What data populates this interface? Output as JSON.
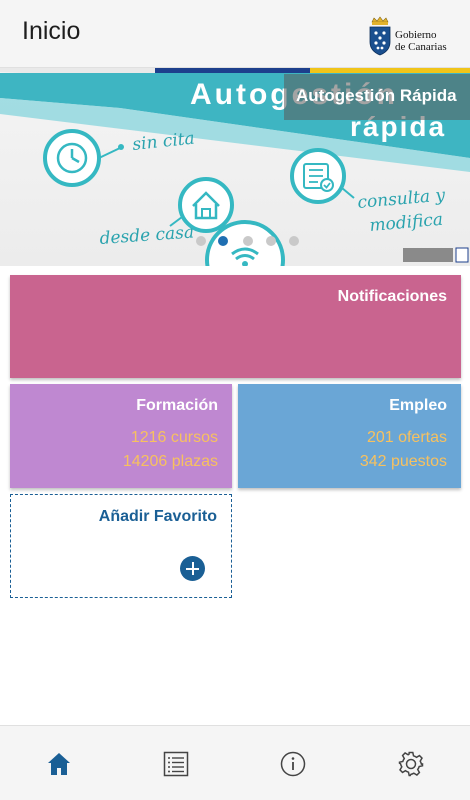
{
  "header": {
    "title": "Inicio",
    "logo_text_line1": "Gobierno",
    "logo_text_line2": "de Canarias"
  },
  "banner": {
    "title": "Autogestión Rápida",
    "image_text": {
      "heading_line1": "Autogestión",
      "heading_line2": "rápida",
      "feature1": "sin cita",
      "feature2": "desde casa",
      "feature3_line1": "consulta y",
      "feature3_line2": "modifica"
    },
    "dots_count": 5,
    "active_dot": 1
  },
  "tiles": {
    "notificaciones": {
      "title": "Notificaciones"
    },
    "formacion": {
      "title": "Formación",
      "line1": "1216 cursos",
      "line2": "14206 plazas"
    },
    "empleo": {
      "title": "Empleo",
      "line1": "201 ofertas",
      "line2": "342 puestos"
    },
    "favorito": {
      "title": "Añadir Favorito"
    }
  },
  "bottom_nav": {
    "items": [
      {
        "name": "home-icon",
        "active": true
      },
      {
        "name": "list-icon",
        "active": false
      },
      {
        "name": "info-icon",
        "active": false
      },
      {
        "name": "gear-icon",
        "active": false
      }
    ]
  },
  "colors": {
    "accent_blue": "#1a5f95",
    "notificaciones": "#c9648f",
    "formacion": "#bf88d1",
    "empleo": "#6aa6d6",
    "tile_value": "#f7c15f",
    "banner_teal": "#35b8c2"
  }
}
